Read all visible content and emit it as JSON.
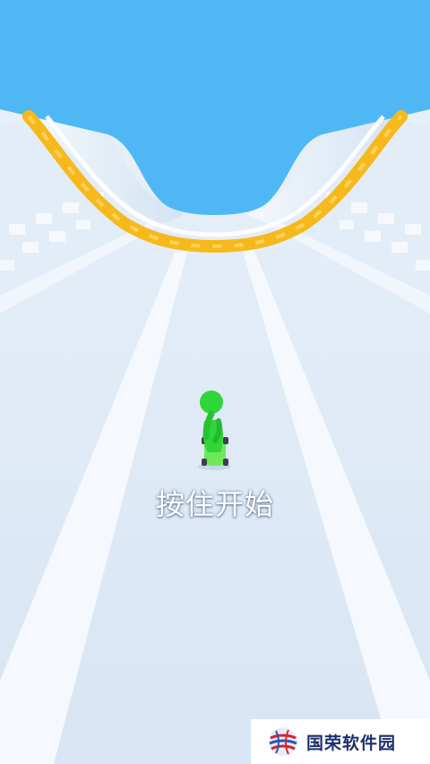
{
  "game": {
    "start_prompt": "按住开始",
    "colors": {
      "sky": "#4fb8f4",
      "track": "#dfeaf6",
      "rail": "#f7b81c",
      "player": "#2fd63a"
    }
  },
  "watermark": {
    "text": "国荣软件园",
    "logo_icon": "globe-logo-icon"
  }
}
